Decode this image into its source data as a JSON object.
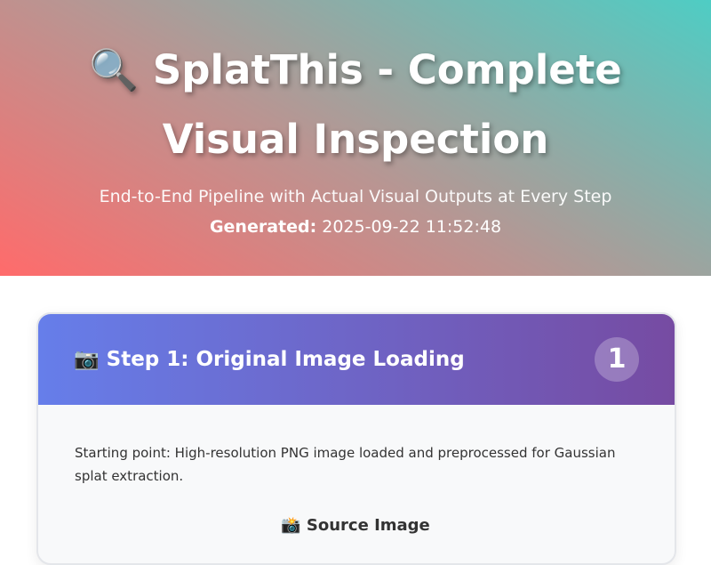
{
  "hero": {
    "title": "🔍 SplatThis - Complete Visual Inspection",
    "subtitle": "End-to-End Pipeline with Actual Visual Outputs at Every Step",
    "generated_label": "Generated:",
    "generated_value": "2025-09-22 11:52:48",
    "gradient": [
      "#ff6b6b",
      "#4ecdc4"
    ]
  },
  "step1": {
    "title": "📷 Step 1: Original Image Loading",
    "number": "1",
    "description": "Starting point: High-resolution PNG image loaded and preprocessed for Gaussian splat extraction.",
    "source_label": "📸 Source Image",
    "header_gradient": [
      "#667eea",
      "#764ba2"
    ]
  }
}
